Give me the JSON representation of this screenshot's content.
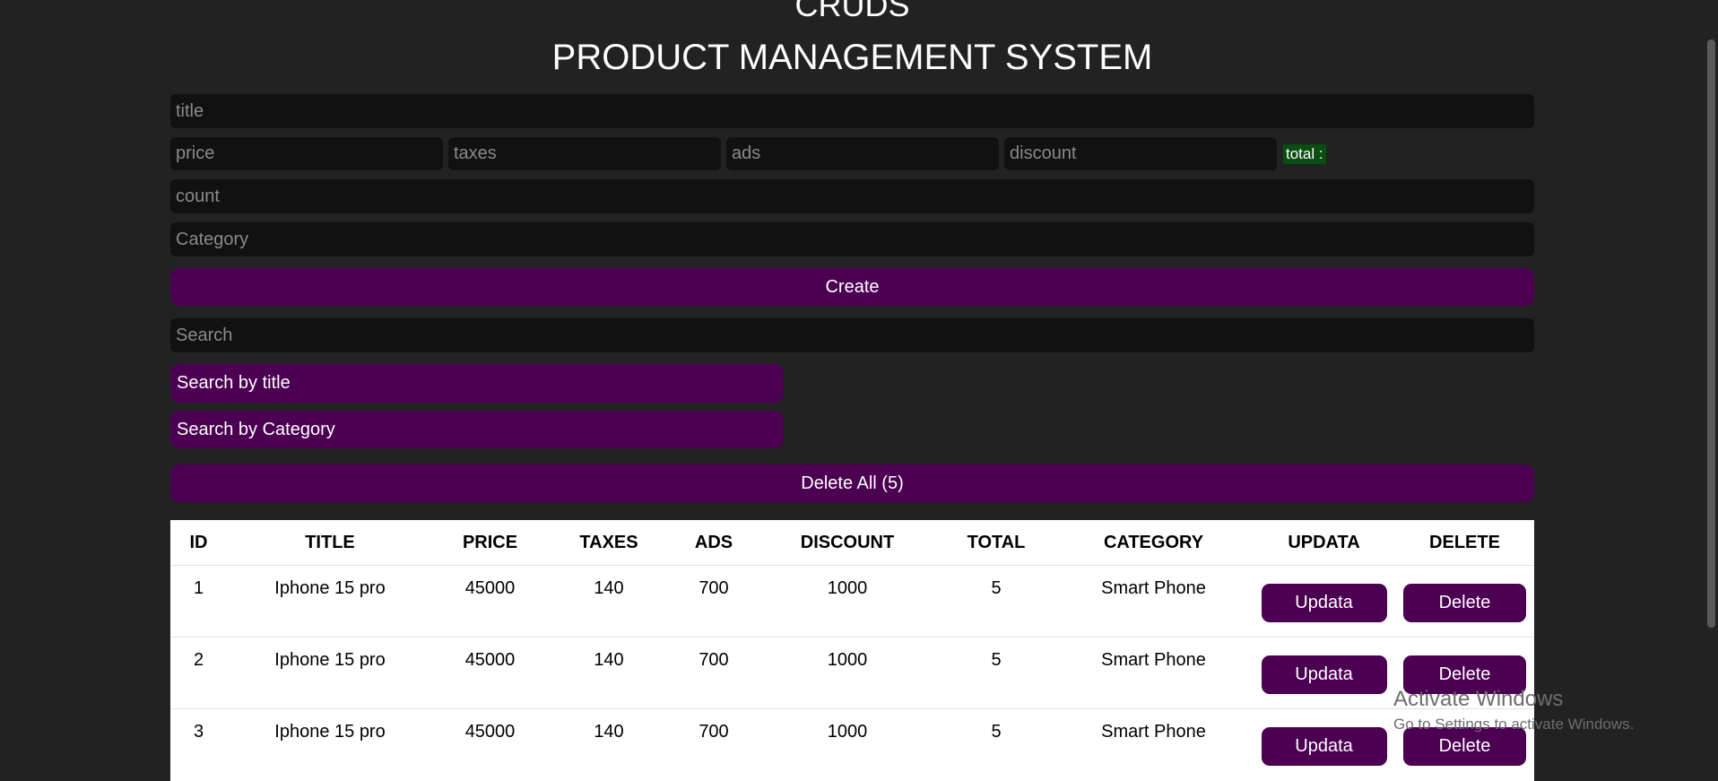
{
  "header": {
    "app_title": "CRUDS",
    "subtitle": "PRODUCT MANAGEMENT SYSTEM"
  },
  "form": {
    "title_placeholder": "title",
    "price_placeholder": "price",
    "taxes_placeholder": "taxes",
    "ads_placeholder": "ads",
    "discount_placeholder": "discount",
    "total_label": "total :",
    "count_placeholder": "count",
    "category_placeholder": "Category",
    "create_label": "Create"
  },
  "search": {
    "placeholder": "Search",
    "by_title_label": "Search by title",
    "by_category_label": "Search by Category"
  },
  "delete_all_label": "Delete All (5)",
  "table": {
    "headers": [
      "ID",
      "TITLE",
      "PRICE",
      "TAXES",
      "ADS",
      "DISCOUNT",
      "TOTAL",
      "CATEGORY",
      "UPDATA",
      "DELETE"
    ],
    "rows": [
      {
        "id": "1",
        "title": "Iphone 15 pro",
        "price": "45000",
        "taxes": "140",
        "ads": "700",
        "discount": "1000",
        "total": "5",
        "category": "Smart Phone",
        "update": "Updata",
        "delete": "Delete"
      },
      {
        "id": "2",
        "title": "Iphone 15 pro",
        "price": "45000",
        "taxes": "140",
        "ads": "700",
        "discount": "1000",
        "total": "5",
        "category": "Smart Phone",
        "update": "Updata",
        "delete": "Delete"
      },
      {
        "id": "3",
        "title": "Iphone 15 pro",
        "price": "45000",
        "taxes": "140",
        "ads": "700",
        "discount": "1000",
        "total": "5",
        "category": "Smart Phone",
        "update": "Updata",
        "delete": "Delete"
      }
    ]
  },
  "overlay": {
    "activate_title": "Activate Windows",
    "activate_sub": "Go to Settings to activate Windows."
  },
  "colors": {
    "background": "#222222",
    "accent": "#4b0052",
    "input_bg": "#111111",
    "total_bg": "#0a4d12"
  }
}
